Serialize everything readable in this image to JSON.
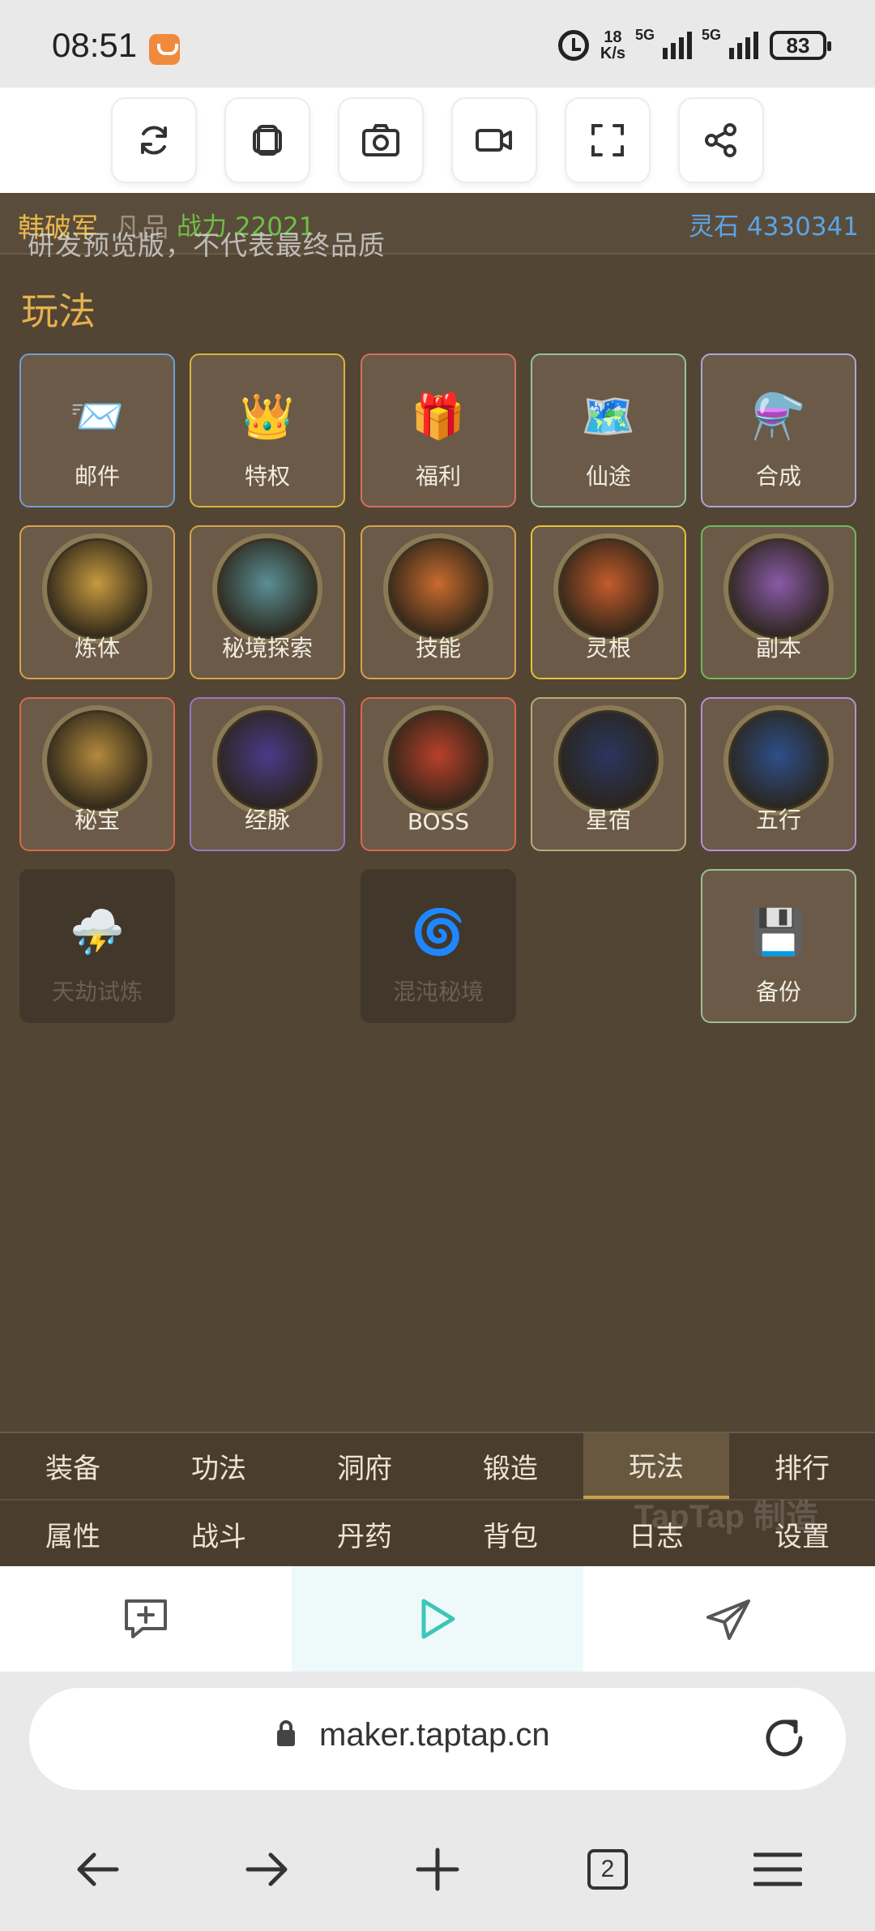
{
  "status_bar": {
    "time": "08:51",
    "speed_value": "18",
    "speed_unit": "K/s",
    "sim1_label": "5G",
    "sim2_label": "5G",
    "battery": "83"
  },
  "toolbar": {
    "buttons": [
      "refresh-icon",
      "copy-icon",
      "screenshot-icon",
      "record-icon",
      "fullscreen-icon",
      "share-icon"
    ]
  },
  "player": {
    "name": "韩破军",
    "rank": "凡品",
    "power_label": "战力 22021",
    "spirit_stone_label": "灵石 4330341"
  },
  "watermark": "研发预览版，不代表最终品质",
  "section_title": "玩法",
  "tiles": [
    {
      "label": "邮件",
      "icon": "📨",
      "border": "#6f9fd1"
    },
    {
      "label": "特权",
      "icon": "👑",
      "border": "#d8b43e"
    },
    {
      "label": "福利",
      "icon": "🎁",
      "border": "#d86e5e"
    },
    {
      "label": "仙途",
      "icon": "🗺️",
      "border": "#8fc59a"
    },
    {
      "label": "合成",
      "icon": "⚗️",
      "border": "#a9a6d8"
    },
    {
      "label": "炼体",
      "border": "#d8a24a",
      "medal": "#c79a3f"
    },
    {
      "label": "秘境探索",
      "border": "#d8a24a",
      "medal": "#5a8f94"
    },
    {
      "label": "技能",
      "border": "#d8a24a",
      "medal": "#c96b2e"
    },
    {
      "label": "灵根",
      "border": "#e6c23a",
      "medal": "#c45b2b"
    },
    {
      "label": "副本",
      "border": "#6fba5a",
      "medal": "#8a5aa8"
    },
    {
      "label": "秘宝",
      "border": "#d8684e",
      "medal": "#b38a3e"
    },
    {
      "label": "经脉",
      "border": "#9a74c9",
      "medal": "#4a3a8a"
    },
    {
      "label": "BOSS",
      "border": "#d8684e",
      "medal": "#b8402a"
    },
    {
      "label": "星宿",
      "border": "#b9ac7a",
      "medal": "#2a3660"
    },
    {
      "label": "五行",
      "border": "#b98fd8",
      "medal": "#2d4f8a"
    },
    {
      "label": "天劫试炼",
      "icon": "⛈️",
      "disabled": true
    },
    {
      "label": "混沌秘境",
      "icon": "🌀",
      "disabled": true
    },
    {
      "label": "备份",
      "icon": "💾",
      "border": "#9dbf8e"
    }
  ],
  "bottom_nav": {
    "row1": [
      "装备",
      "功法",
      "洞府",
      "锻造",
      "玩法",
      "排行"
    ],
    "row2": [
      "属性",
      "战斗",
      "丹药",
      "背包",
      "日志",
      "设置"
    ],
    "active": "玩法"
  },
  "brand_watermark": "TapTap 制造",
  "address_bar": {
    "url": "maker.taptap.cn"
  },
  "browser_nav": {
    "tab_count": "2"
  }
}
